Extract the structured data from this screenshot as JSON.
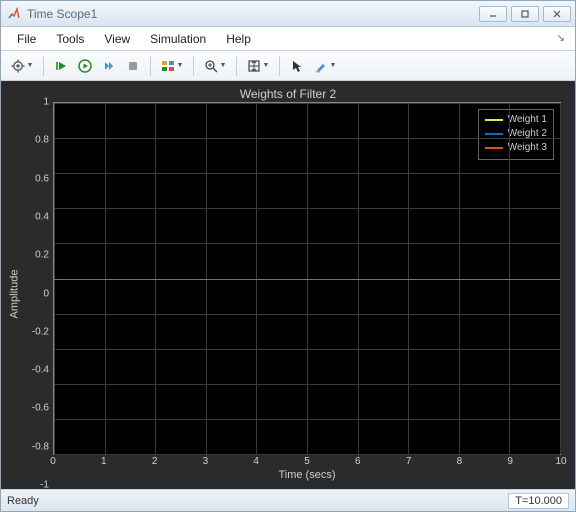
{
  "window": {
    "title": "Time Scope1"
  },
  "menubar": {
    "items": [
      "File",
      "Tools",
      "View",
      "Simulation",
      "Help"
    ]
  },
  "toolbar": {
    "icons": [
      "gear-icon",
      "restart-icon",
      "run-icon",
      "step-forward-icon",
      "stop-icon",
      "layout-icon",
      "zoom-in-icon",
      "autoscale-icon",
      "cursor-icon",
      "highlight-icon"
    ]
  },
  "chart": {
    "title": "Weights of Filter 2",
    "xlabel": "Time (secs)",
    "ylabel": "Amplitude"
  },
  "chart_data": {
    "type": "line",
    "x": [
      0,
      1,
      2,
      3,
      4,
      5,
      6,
      7,
      8,
      9,
      10
    ],
    "series": [
      {
        "name": "Weight 1",
        "color": "#f0e442",
        "values": [
          0,
          0,
          0,
          0,
          0,
          0,
          0,
          0,
          0,
          0,
          0
        ]
      },
      {
        "name": "Weight 2",
        "color": "#0072bd",
        "values": [
          0,
          0,
          0,
          0,
          0,
          0,
          0,
          0,
          0,
          0,
          0
        ]
      },
      {
        "name": "Weight 3",
        "color": "#d95319",
        "values": [
          0,
          0,
          0,
          0,
          0,
          0,
          0,
          0,
          0,
          0,
          0
        ]
      }
    ],
    "xlim": [
      0,
      10
    ],
    "ylim": [
      -1,
      1
    ],
    "xticks": [
      0,
      1,
      2,
      3,
      4,
      5,
      6,
      7,
      8,
      9,
      10
    ],
    "yticks": [
      -1,
      -0.8,
      -0.6,
      -0.4,
      -0.2,
      0,
      0.2,
      0.4,
      0.6,
      0.8,
      1
    ],
    "grid": true,
    "legend_position": "top-right"
  },
  "status": {
    "ready": "Ready",
    "time": "T=10.000"
  }
}
